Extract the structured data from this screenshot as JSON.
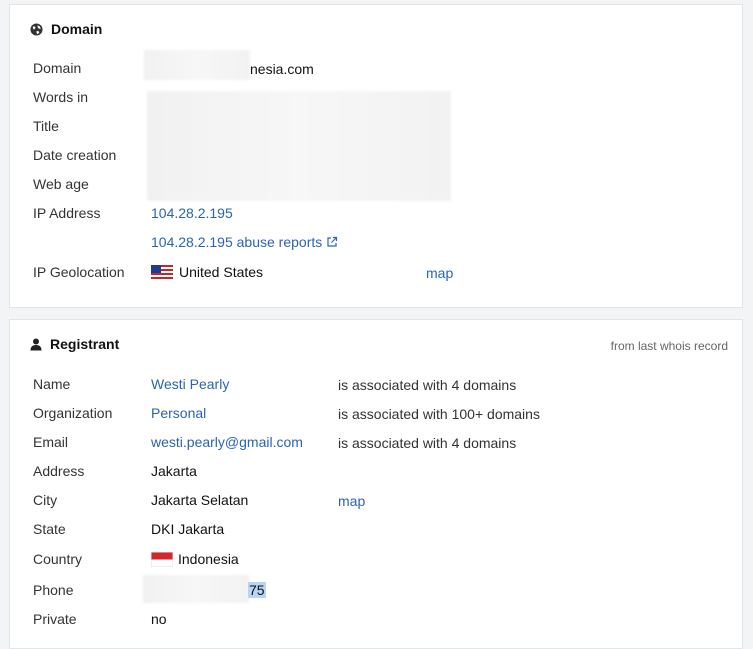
{
  "domain_card": {
    "title": "Domain",
    "icon": "globe-icon",
    "rows": {
      "domain_label": "Domain",
      "domain_value": "nesia.com",
      "words_label": "Words in",
      "title_label": "Title",
      "date_label": "Date creation",
      "webage_label": "Web age",
      "ip_label": "IP Address",
      "ip_value": "104.28.2.195",
      "abuse_value": "104.28.2.195 abuse reports",
      "geo_label": "IP Geolocation",
      "geo_value": "United States",
      "geo_map": "map"
    }
  },
  "registrant_card": {
    "title": "Registrant",
    "icon": "user-icon",
    "note": "from last whois record",
    "rows": {
      "name_label": "Name",
      "name_value": "Westi Pearly",
      "name_assoc": "is associated with 4 domains",
      "org_label": "Organization",
      "org_value": "Personal",
      "org_assoc": "is associated with 100+ domains",
      "email_label": "Email",
      "email_value": "westi.pearly@gmail.com",
      "email_assoc": "is associated with 4 domains",
      "address_label": "Address",
      "address_value": "Jakarta",
      "city_label": "City",
      "city_value": "Jakarta Selatan",
      "city_map": "map",
      "state_label": "State",
      "state_value": "DKI Jakarta",
      "country_label": "Country",
      "country_value": "Indonesia",
      "phone_label": "Phone",
      "phone_value": "75",
      "private_label": "Private",
      "private_value": "no"
    }
  },
  "colors": {
    "link": "#2a63b3",
    "selection": "#b9d4f5"
  }
}
